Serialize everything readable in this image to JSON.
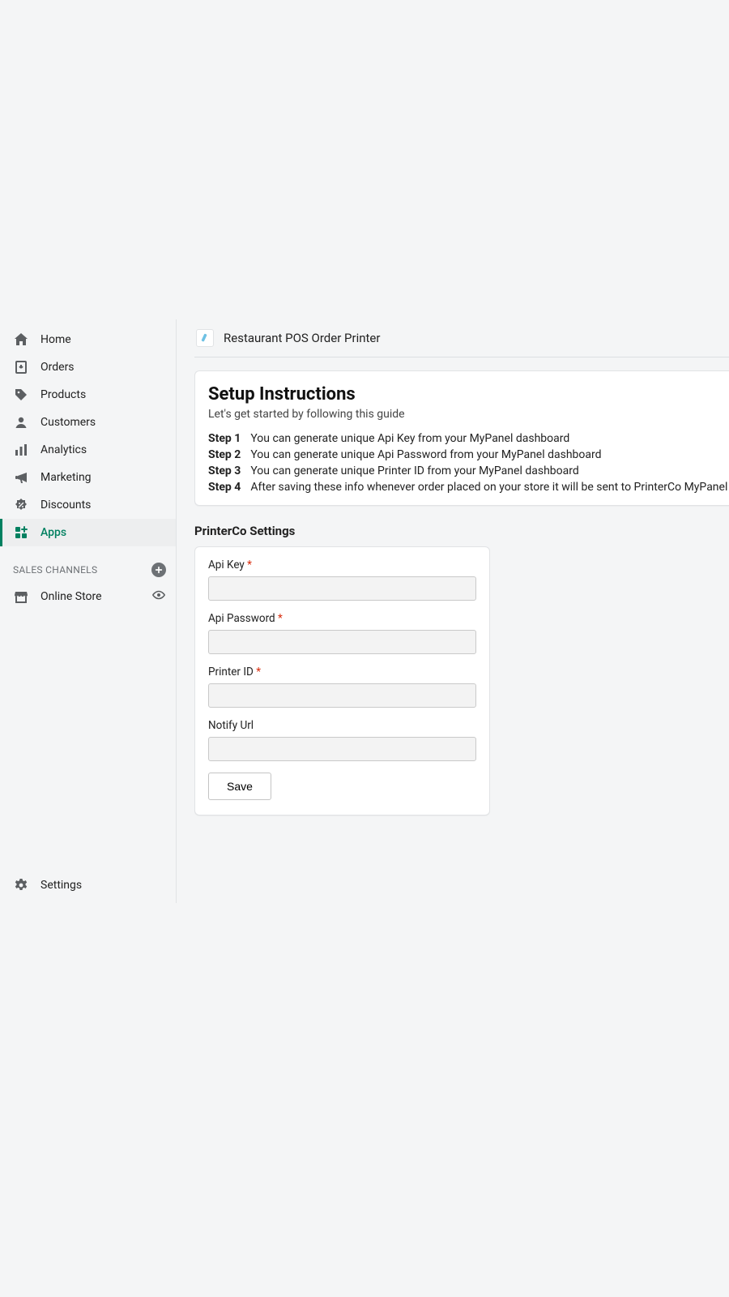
{
  "sidebar": {
    "items": [
      {
        "label": "Home"
      },
      {
        "label": "Orders"
      },
      {
        "label": "Products"
      },
      {
        "label": "Customers"
      },
      {
        "label": "Analytics"
      },
      {
        "label": "Marketing"
      },
      {
        "label": "Discounts"
      },
      {
        "label": "Apps"
      }
    ],
    "sales_channels_header": "SALES CHANNELS",
    "online_store_label": "Online Store",
    "settings_label": "Settings"
  },
  "app": {
    "title": "Restaurant POS Order Printer"
  },
  "setup": {
    "heading": "Setup Instructions",
    "subtitle": "Let's get started by following this guide",
    "steps": [
      {
        "label": "Step 1",
        "text": "You can generate unique Api Key from your MyPanel dashboard"
      },
      {
        "label": "Step 2",
        "text": "You can generate unique Api Password from your MyPanel dashboard"
      },
      {
        "label": "Step 3",
        "text": "You can generate unique Printer ID from your MyPanel dashboard"
      },
      {
        "label": "Step 4",
        "text": "After saving these info whenever order placed on your store it will be sent to PrinterCo MyPanel dashboard. PrinterCo MyPanel dashboard link is: https://mypanel.printerco"
      }
    ]
  },
  "settings": {
    "heading": "PrinterCo Settings",
    "fields": {
      "api_key_label": "Api Key",
      "api_password_label": "Api Password",
      "printer_id_label": "Printer ID",
      "notify_url_label": "Notify Url"
    },
    "save_label": "Save"
  }
}
